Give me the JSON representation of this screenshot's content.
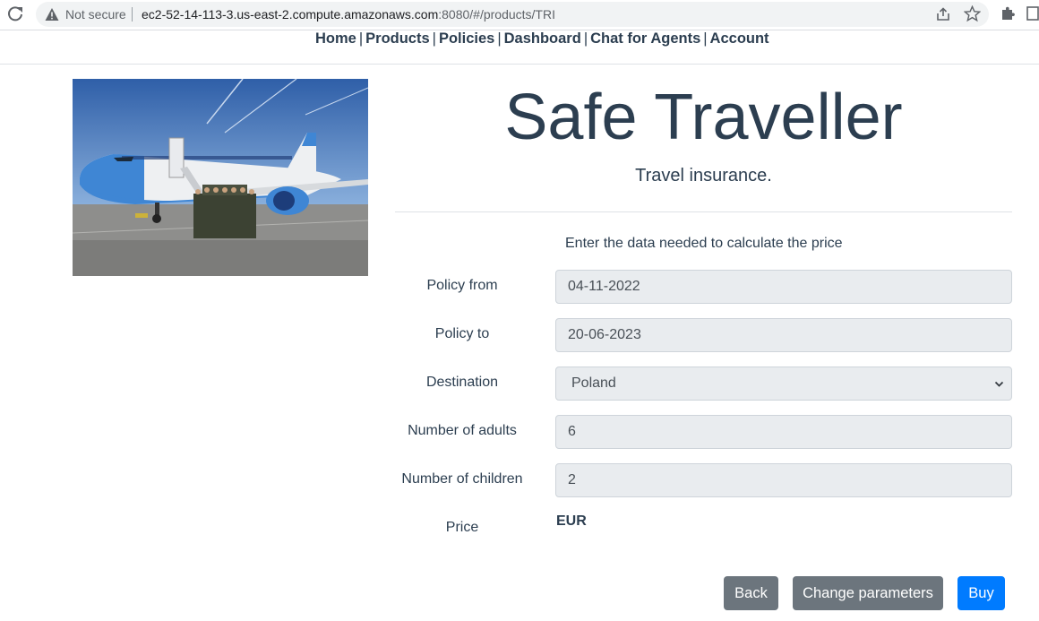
{
  "browser": {
    "security_label": "Not secure",
    "url_host": "ec2-52-14-113-3.us-east-2.compute.amazonaws.com",
    "url_rest": ":8080/#/products/TRI"
  },
  "nav": {
    "items": [
      "Home",
      "Products",
      "Policies",
      "Dashboard",
      "Chat for Agents",
      "Account"
    ]
  },
  "product": {
    "title": "Safe Traveller",
    "subtitle": "Travel insurance.",
    "instructions": "Enter the data needed to calculate the price"
  },
  "form": {
    "policy_from": {
      "label": "Policy from",
      "value": "04-11-2022"
    },
    "policy_to": {
      "label": "Policy to",
      "value": "20-06-2023"
    },
    "destination": {
      "label": "Destination",
      "value": "Poland"
    },
    "adults": {
      "label": "Number of adults",
      "value": "6"
    },
    "children": {
      "label": "Number of children",
      "value": "2"
    },
    "price": {
      "label": "Price",
      "value": "EUR"
    }
  },
  "actions": {
    "back": "Back",
    "change": "Change parameters",
    "buy": "Buy"
  },
  "colors": {
    "text": "#2c3e50",
    "secondary_button": "#6c757d",
    "primary_button": "#007bff",
    "field_bg": "#e9ecef"
  }
}
